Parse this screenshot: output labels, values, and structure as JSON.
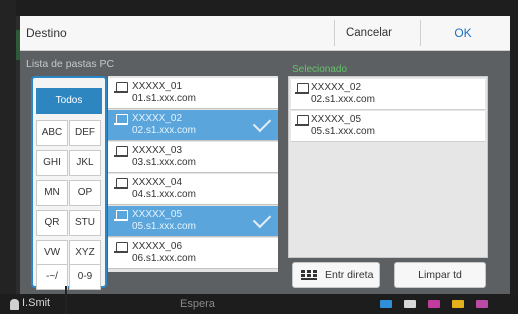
{
  "dialog": {
    "title": "Destino",
    "cancel_label": "Cancelar",
    "ok_label": "OK"
  },
  "left_panel": {
    "title": "Lista de pastas PC"
  },
  "filter_buttons": [
    "Todos",
    "ABC",
    "DEF",
    "GHI",
    "JKL",
    "MN",
    "OP",
    "QR",
    "STU",
    "VW",
    "XYZ",
    "-~/",
    "0-9"
  ],
  "pc_list": [
    {
      "name": "XXXXX_01",
      "host": "01.s1.xxx.com",
      "selected": false
    },
    {
      "name": "XXXXX_02",
      "host": "02.s1.xxx.com",
      "selected": true
    },
    {
      "name": "XXXXX_03",
      "host": "03.s1.xxx.com",
      "selected": false
    },
    {
      "name": "XXXXX_04",
      "host": "04.s1.xxx.com",
      "selected": false
    },
    {
      "name": "XXXXX_05",
      "host": "05.s1.xxx.com",
      "selected": true
    },
    {
      "name": "XXXXX_06",
      "host": "06.s1.xxx.com",
      "selected": false
    }
  ],
  "right_panel": {
    "title": "Selecionado"
  },
  "selected_list": [
    {
      "name": "XXXXX_02",
      "host": "02.s1.xxx.com"
    },
    {
      "name": "XXXXX_05",
      "host": "05.s1.xxx.com"
    }
  ],
  "actions": {
    "direct_entry_label": "Entr direta",
    "clear_label": "Limpar td"
  },
  "status_bar": {
    "user": "I.Smit",
    "mode": "Espera"
  },
  "colors": {
    "accent": "#2e86c1",
    "selected_row": "#5aa6dc",
    "selected_title": "#65c36a",
    "ok_text": "#1e6fbf"
  }
}
